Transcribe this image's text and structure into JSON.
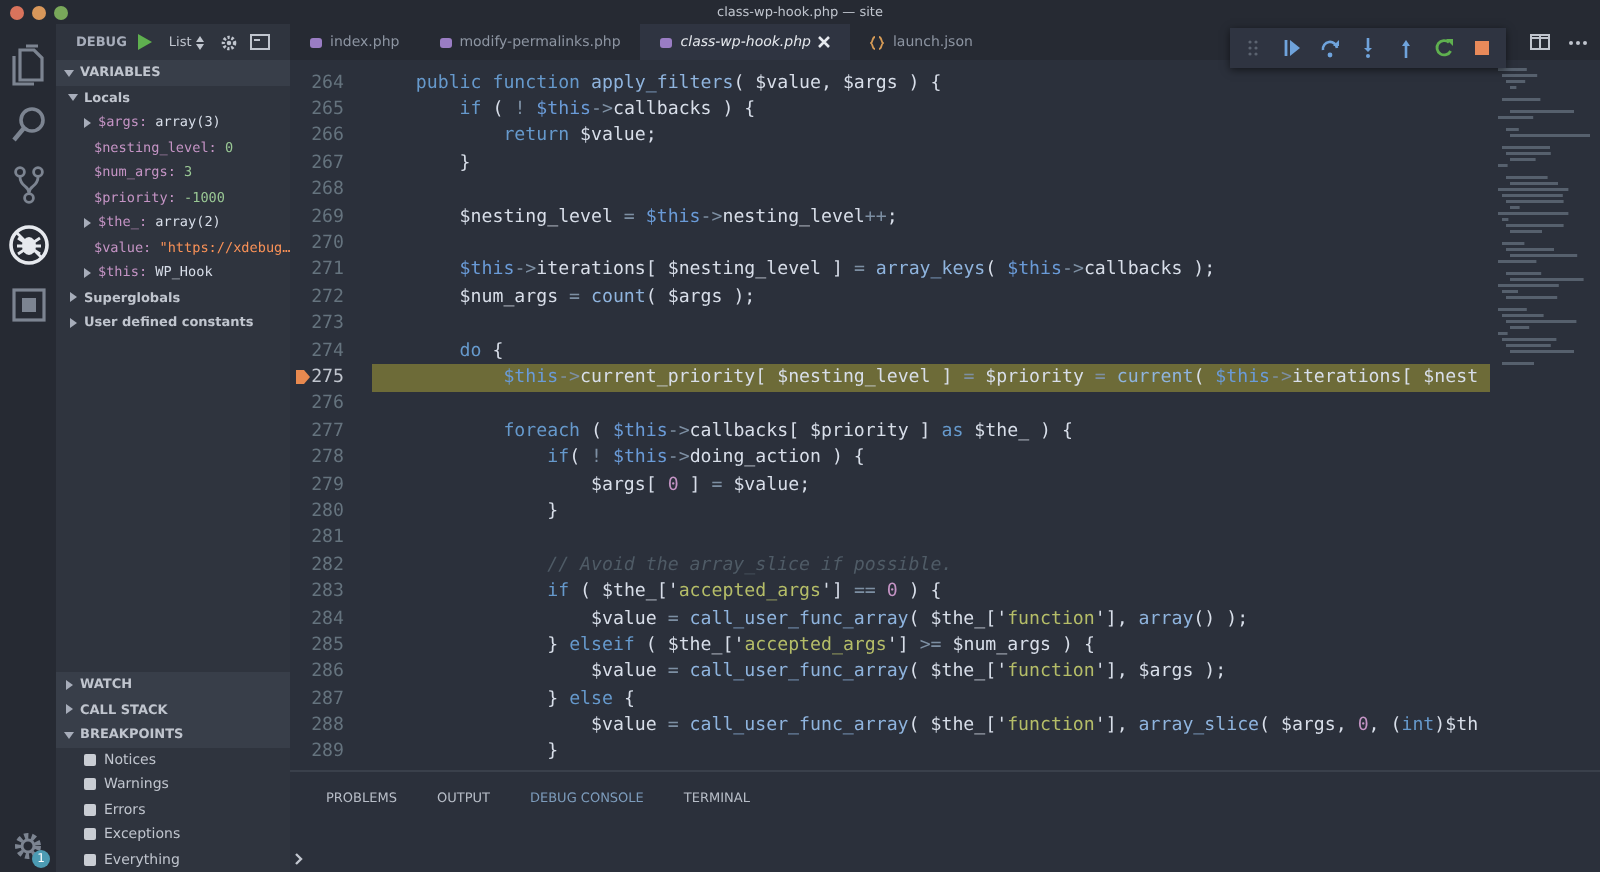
{
  "window": {
    "title": "class-wp-hook.php — site"
  },
  "activity_bar": {
    "items": [
      {
        "kind": "files",
        "selected": false
      },
      {
        "kind": "search",
        "selected": false
      },
      {
        "kind": "source_control",
        "selected": false
      },
      {
        "kind": "debug",
        "selected": true
      },
      {
        "kind": "extensions",
        "selected": false
      }
    ],
    "manage": {
      "badge": "1"
    }
  },
  "sidebar": {
    "title": "DEBUG",
    "configuration": "List",
    "sections": [
      {
        "kind": "variables",
        "label": "VARIABLES",
        "expanded": true,
        "scopes": [
          {
            "label": "Locals",
            "expanded": true,
            "children": [
              {
                "name": "$args:",
                "value": "array(3)",
                "kind": "object",
                "expanded": false
              },
              {
                "name": "$nesting_level:",
                "value": "0",
                "kind": "number"
              },
              {
                "name": "$num_args:",
                "value": "3",
                "kind": "number"
              },
              {
                "name": "$priority:",
                "value": "-1000",
                "kind": "number"
              },
              {
                "name": "$the_:",
                "value": "array(2)",
                "kind": "object",
                "expanded": false
              },
              {
                "name": "$value:",
                "value": "\"https://xdebug…",
                "kind": "string"
              },
              {
                "name": "$this:",
                "value": "WP_Hook",
                "kind": "object",
                "expanded": false
              }
            ]
          },
          {
            "label": "Superglobals",
            "expanded": false
          },
          {
            "label": "User defined constants",
            "expanded": false
          }
        ]
      },
      {
        "kind": "plain",
        "label": "WATCH",
        "expanded": false
      },
      {
        "kind": "plain",
        "label": "CALL STACK",
        "expanded": false
      },
      {
        "kind": "breakpoints",
        "label": "BREAKPOINTS",
        "expanded": true,
        "items": [
          {
            "label": "Notices",
            "checked": false
          },
          {
            "label": "Warnings",
            "checked": false
          },
          {
            "label": "Errors",
            "checked": false
          },
          {
            "label": "Exceptions",
            "checked": false
          },
          {
            "label": "Everything",
            "checked": false
          }
        ]
      }
    ]
  },
  "tabs": [
    {
      "label": "index.php",
      "kind": "php",
      "selected": false
    },
    {
      "label": "modify-permalinks.php",
      "kind": "php",
      "selected": false
    },
    {
      "label": "class-wp-hook.php",
      "kind": "php",
      "selected": true
    },
    {
      "label": "launch.json",
      "kind": "json",
      "selected": false
    }
  ],
  "code": {
    "lines": [
      {
        "number": "264",
        "current": false,
        "tokens": [
          {
            "kind": "kw",
            "text": "    public"
          },
          {
            "kind": "kw",
            "text": " function"
          },
          {
            "kind": "fn",
            "text": " apply_filters"
          },
          {
            "kind": "pl",
            "text": "( "
          },
          {
            "kind": "var",
            "text": "$value"
          },
          {
            "kind": "pl",
            "text": ", "
          },
          {
            "kind": "var",
            "text": "$args"
          },
          {
            "kind": "pl",
            "text": " ) {"
          }
        ]
      },
      {
        "number": "265",
        "current": false,
        "tokens": [
          {
            "kind": "kw",
            "text": "        if"
          },
          {
            "kind": "pl",
            "text": " ( "
          },
          {
            "kind": "op",
            "text": "!"
          },
          {
            "kind": "th",
            "text": " $this"
          },
          {
            "kind": "op",
            "text": "->"
          },
          {
            "kind": "pl",
            "text": "callbacks ) {"
          }
        ]
      },
      {
        "number": "266",
        "current": false,
        "tokens": [
          {
            "kind": "kw",
            "text": "            return"
          },
          {
            "kind": "var",
            "text": " $value"
          },
          {
            "kind": "pl",
            "text": ";"
          }
        ]
      },
      {
        "number": "267",
        "current": false,
        "tokens": [
          {
            "kind": "pl",
            "text": "        }"
          }
        ]
      },
      {
        "number": "268",
        "current": false
      },
      {
        "number": "269",
        "current": false,
        "tokens": [
          {
            "kind": "var",
            "text": "        $nesting_level"
          },
          {
            "kind": "op",
            "text": " ="
          },
          {
            "kind": "th",
            "text": " $this"
          },
          {
            "kind": "op",
            "text": "->"
          },
          {
            "kind": "pl",
            "text": "nesting_level"
          },
          {
            "kind": "op",
            "text": "++"
          },
          {
            "kind": "pl",
            "text": ";"
          }
        ]
      },
      {
        "number": "270",
        "current": false
      },
      {
        "number": "271",
        "current": false,
        "tokens": [
          {
            "kind": "th",
            "text": "        $this"
          },
          {
            "kind": "op",
            "text": "->"
          },
          {
            "kind": "pl",
            "text": "iterations[ "
          },
          {
            "kind": "var",
            "text": "$nesting_level"
          },
          {
            "kind": "pl",
            "text": " ] "
          },
          {
            "kind": "op",
            "text": "="
          },
          {
            "kind": "fn",
            "text": " array_keys"
          },
          {
            "kind": "pl",
            "text": "( "
          },
          {
            "kind": "th",
            "text": "$this"
          },
          {
            "kind": "op",
            "text": "->"
          },
          {
            "kind": "pl",
            "text": "callbacks );"
          }
        ]
      },
      {
        "number": "272",
        "current": false,
        "tokens": [
          {
            "kind": "var",
            "text": "        $num_args"
          },
          {
            "kind": "op",
            "text": " ="
          },
          {
            "kind": "fn",
            "text": " count"
          },
          {
            "kind": "pl",
            "text": "( "
          },
          {
            "kind": "var",
            "text": "$args"
          },
          {
            "kind": "pl",
            "text": " );"
          }
        ]
      },
      {
        "number": "273",
        "current": false
      },
      {
        "number": "274",
        "current": false,
        "tokens": [
          {
            "kind": "kw",
            "text": "        do"
          },
          {
            "kind": "pl",
            "text": " {"
          }
        ]
      },
      {
        "number": "275",
        "current": true,
        "tokens": [
          {
            "kind": "th",
            "text": "            $this"
          },
          {
            "kind": "op",
            "text": "->"
          },
          {
            "kind": "pl",
            "text": "current_priority[ "
          },
          {
            "kind": "var",
            "text": "$nesting_level"
          },
          {
            "kind": "pl",
            "text": " ] "
          },
          {
            "kind": "op",
            "text": "="
          },
          {
            "kind": "var",
            "text": " $priority"
          },
          {
            "kind": "op",
            "text": " ="
          },
          {
            "kind": "fn",
            "text": " current"
          },
          {
            "kind": "pl",
            "text": "( "
          },
          {
            "kind": "th",
            "text": "$this"
          },
          {
            "kind": "op",
            "text": "->"
          },
          {
            "kind": "pl",
            "text": "iterations[ "
          },
          {
            "kind": "var",
            "text": "$nest"
          }
        ]
      },
      {
        "number": "276",
        "current": false
      },
      {
        "number": "277",
        "current": false,
        "tokens": [
          {
            "kind": "kw",
            "text": "            foreach"
          },
          {
            "kind": "pl",
            "text": " ( "
          },
          {
            "kind": "th",
            "text": "$this"
          },
          {
            "kind": "op",
            "text": "->"
          },
          {
            "kind": "pl",
            "text": "callbacks[ "
          },
          {
            "kind": "var",
            "text": "$priority"
          },
          {
            "kind": "pl",
            "text": " ] "
          },
          {
            "kind": "kw",
            "text": "as"
          },
          {
            "kind": "var",
            "text": " $the_"
          },
          {
            "kind": "pl",
            "text": " ) {"
          }
        ]
      },
      {
        "number": "278",
        "current": false,
        "tokens": [
          {
            "kind": "kw",
            "text": "                if"
          },
          {
            "kind": "pl",
            "text": "( "
          },
          {
            "kind": "op",
            "text": "!"
          },
          {
            "kind": "th",
            "text": " $this"
          },
          {
            "kind": "op",
            "text": "->"
          },
          {
            "kind": "pl",
            "text": "doing_action ) {"
          }
        ]
      },
      {
        "number": "279",
        "current": false,
        "tokens": [
          {
            "kind": "var",
            "text": "                    $args"
          },
          {
            "kind": "pl",
            "text": "[ "
          },
          {
            "kind": "num",
            "text": "0"
          },
          {
            "kind": "pl",
            "text": " ] "
          },
          {
            "kind": "op",
            "text": "="
          },
          {
            "kind": "var",
            "text": " $value"
          },
          {
            "kind": "pl",
            "text": ";"
          }
        ]
      },
      {
        "number": "280",
        "current": false,
        "tokens": [
          {
            "kind": "pl",
            "text": "                }"
          }
        ]
      },
      {
        "number": "281",
        "current": false
      },
      {
        "number": "282",
        "current": false,
        "tokens": [
          {
            "kind": "cm",
            "text": "                // Avoid the array_slice if possible."
          }
        ]
      },
      {
        "number": "283",
        "current": false,
        "tokens": [
          {
            "kind": "kw",
            "text": "                if"
          },
          {
            "kind": "pl",
            "text": " ( "
          },
          {
            "kind": "var",
            "text": "$the_"
          },
          {
            "kind": "pl",
            "text": "['"
          },
          {
            "kind": "str",
            "text": "accepted_args"
          },
          {
            "kind": "pl",
            "text": "'] "
          },
          {
            "kind": "op",
            "text": "=="
          },
          {
            "kind": "num",
            "text": " 0"
          },
          {
            "kind": "pl",
            "text": " ) {"
          }
        ]
      },
      {
        "number": "284",
        "current": false,
        "tokens": [
          {
            "kind": "var",
            "text": "                    $value"
          },
          {
            "kind": "op",
            "text": " ="
          },
          {
            "kind": "fn",
            "text": " call_user_func_array"
          },
          {
            "kind": "pl",
            "text": "( "
          },
          {
            "kind": "var",
            "text": "$the_"
          },
          {
            "kind": "pl",
            "text": "['"
          },
          {
            "kind": "str",
            "text": "function"
          },
          {
            "kind": "pl",
            "text": "'], "
          },
          {
            "kind": "fn",
            "text": "array"
          },
          {
            "kind": "pl",
            "text": "() );"
          }
        ]
      },
      {
        "number": "285",
        "current": false,
        "tokens": [
          {
            "kind": "pl",
            "text": "                } "
          },
          {
            "kind": "kw",
            "text": "elseif"
          },
          {
            "kind": "pl",
            "text": " ( "
          },
          {
            "kind": "var",
            "text": "$the_"
          },
          {
            "kind": "pl",
            "text": "['"
          },
          {
            "kind": "str",
            "text": "accepted_args"
          },
          {
            "kind": "pl",
            "text": "'] "
          },
          {
            "kind": "op",
            "text": ">="
          },
          {
            "kind": "var",
            "text": " $num_args"
          },
          {
            "kind": "pl",
            "text": " ) {"
          }
        ]
      },
      {
        "number": "286",
        "current": false,
        "tokens": [
          {
            "kind": "var",
            "text": "                    $value"
          },
          {
            "kind": "op",
            "text": " ="
          },
          {
            "kind": "fn",
            "text": " call_user_func_array"
          },
          {
            "kind": "pl",
            "text": "( "
          },
          {
            "kind": "var",
            "text": "$the_"
          },
          {
            "kind": "pl",
            "text": "['"
          },
          {
            "kind": "str",
            "text": "function"
          },
          {
            "kind": "pl",
            "text": "'], "
          },
          {
            "kind": "var",
            "text": "$args"
          },
          {
            "kind": "pl",
            "text": " );"
          }
        ]
      },
      {
        "number": "287",
        "current": false,
        "tokens": [
          {
            "kind": "pl",
            "text": "                } "
          },
          {
            "kind": "kw",
            "text": "else"
          },
          {
            "kind": "pl",
            "text": " {"
          }
        ]
      },
      {
        "number": "288",
        "current": false,
        "tokens": [
          {
            "kind": "var",
            "text": "                    $value"
          },
          {
            "kind": "op",
            "text": " ="
          },
          {
            "kind": "fn",
            "text": " call_user_func_array"
          },
          {
            "kind": "pl",
            "text": "( "
          },
          {
            "kind": "var",
            "text": "$the_"
          },
          {
            "kind": "pl",
            "text": "['"
          },
          {
            "kind": "str",
            "text": "function"
          },
          {
            "kind": "pl",
            "text": "'], "
          },
          {
            "kind": "fn",
            "text": "array_slice"
          },
          {
            "kind": "pl",
            "text": "( "
          },
          {
            "kind": "var",
            "text": "$args"
          },
          {
            "kind": "pl",
            "text": ", "
          },
          {
            "kind": "num",
            "text": "0"
          },
          {
            "kind": "pl",
            "text": ", ("
          },
          {
            "kind": "kw",
            "text": "int"
          },
          {
            "kind": "pl",
            "text": ")"
          },
          {
            "kind": "var",
            "text": "$th"
          }
        ]
      },
      {
        "number": "289",
        "current": false,
        "tokens": [
          {
            "kind": "pl",
            "text": "                }"
          }
        ]
      }
    ]
  },
  "panel": {
    "tabs": [
      {
        "label": "PROBLEMS",
        "selected": false
      },
      {
        "label": "OUTPUT",
        "selected": false
      },
      {
        "label": "DEBUG CONSOLE",
        "selected": true
      },
      {
        "label": "TERMINAL",
        "selected": false
      }
    ]
  }
}
